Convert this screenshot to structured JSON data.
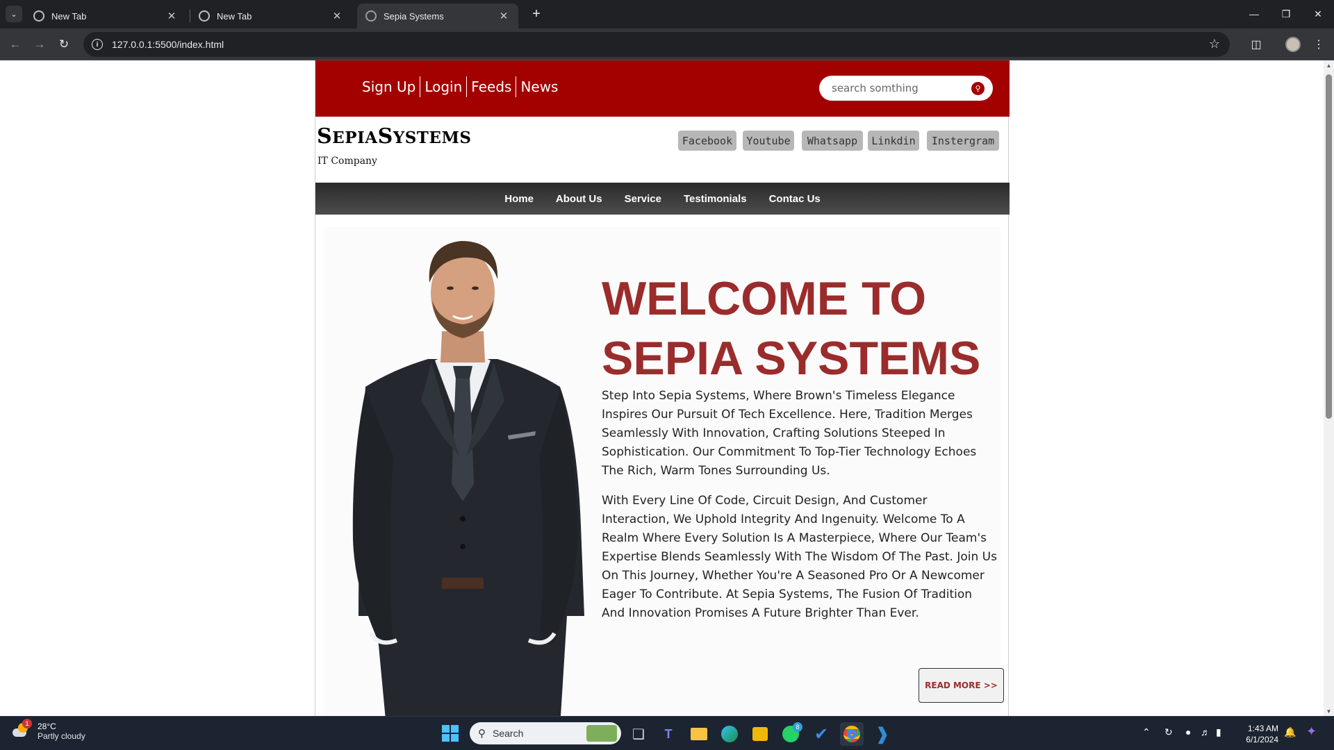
{
  "browser": {
    "tabs": [
      {
        "title": "New Tab",
        "active": false
      },
      {
        "title": "New Tab",
        "active": false
      },
      {
        "title": "Sepia Systems",
        "active": true
      }
    ],
    "url": "127.0.0.1:5500/index.html"
  },
  "site": {
    "top_links": [
      "Sign Up",
      "Login",
      "Feeds",
      "News"
    ],
    "search_placeholder": "search somthing",
    "brand": {
      "first_cap": "S",
      "first_rest": "EPIA",
      "second_cap": "S",
      "second_rest": "YSTEMS",
      "tagline": "IT Company"
    },
    "social": [
      "Facebook",
      "Youtube",
      "Whatsapp",
      "Linkdin",
      "Instergram"
    ],
    "nav": [
      "Home",
      "About Us",
      "Service",
      "Testimonials",
      "Contac Us"
    ],
    "hero": {
      "title_line1": "WELCOME TO",
      "title_line2": "SEPIA SYSTEMS",
      "paragraph1": "Step Into Sepia Systems, Where Brown's Timeless Elegance Inspires Our Pursuit Of Tech Excellence. Here, Tradition Merges Seamlessly With Innovation, Crafting Solutions Steeped In Sophistication. Our Commitment To Top-Tier Technology Echoes The Rich, Warm Tones Surrounding Us.",
      "paragraph2": "With Every Line Of Code, Circuit Design, And Customer Interaction, We Uphold Integrity And Ingenuity. Welcome To A Realm Where Every Solution Is A Masterpiece, Where Our Team's Expertise Blends Seamlessly With The Wisdom Of The Past. Join Us On This Journey, Whether You're A Seasoned Pro Or A Newcomer Eager To Contribute. At Sepia Systems, The Fusion Of Tradition And Innovation Promises A Future Brighter Than Ever.",
      "read_more": "READ MORE >>"
    }
  },
  "taskbar": {
    "weather_temp": "28°C",
    "weather_desc": "Partly cloudy",
    "weather_badge": "1",
    "search_label": "Search",
    "whatsapp_badge": "8",
    "time": "1:43 AM",
    "date": "6/1/2024"
  },
  "colors": {
    "brand_red": "#a30000",
    "title_red": "#9b2c2c",
    "nav_dark": "#333333"
  }
}
